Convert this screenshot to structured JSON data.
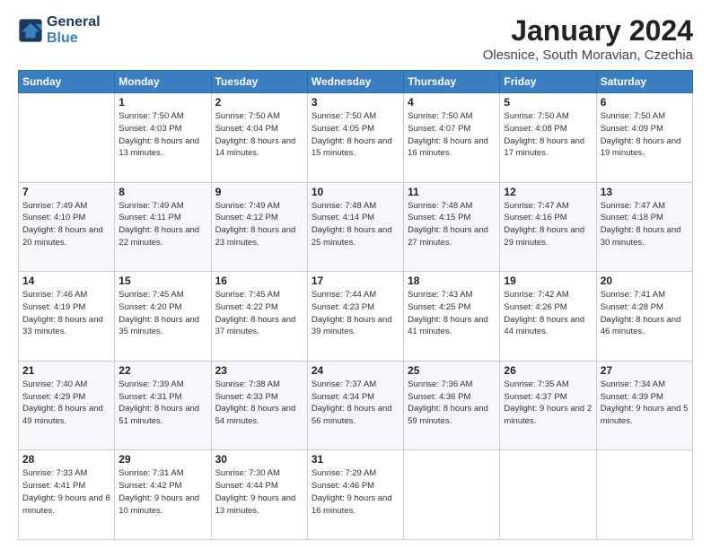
{
  "header": {
    "logo_line1": "General",
    "logo_line2": "Blue",
    "title": "January 2024",
    "subtitle": "Olesnice, South Moravian, Czechia"
  },
  "weekdays": [
    "Sunday",
    "Monday",
    "Tuesday",
    "Wednesday",
    "Thursday",
    "Friday",
    "Saturday"
  ],
  "weeks": [
    [
      {
        "day": "",
        "sunrise": "",
        "sunset": "",
        "daylight": ""
      },
      {
        "day": "1",
        "sunrise": "Sunrise: 7:50 AM",
        "sunset": "Sunset: 4:03 PM",
        "daylight": "Daylight: 8 hours and 13 minutes."
      },
      {
        "day": "2",
        "sunrise": "Sunrise: 7:50 AM",
        "sunset": "Sunset: 4:04 PM",
        "daylight": "Daylight: 8 hours and 14 minutes."
      },
      {
        "day": "3",
        "sunrise": "Sunrise: 7:50 AM",
        "sunset": "Sunset: 4:05 PM",
        "daylight": "Daylight: 8 hours and 15 minutes."
      },
      {
        "day": "4",
        "sunrise": "Sunrise: 7:50 AM",
        "sunset": "Sunset: 4:07 PM",
        "daylight": "Daylight: 8 hours and 16 minutes."
      },
      {
        "day": "5",
        "sunrise": "Sunrise: 7:50 AM",
        "sunset": "Sunset: 4:08 PM",
        "daylight": "Daylight: 8 hours and 17 minutes."
      },
      {
        "day": "6",
        "sunrise": "Sunrise: 7:50 AM",
        "sunset": "Sunset: 4:09 PM",
        "daylight": "Daylight: 8 hours and 19 minutes."
      }
    ],
    [
      {
        "day": "7",
        "sunrise": "Sunrise: 7:49 AM",
        "sunset": "Sunset: 4:10 PM",
        "daylight": "Daylight: 8 hours and 20 minutes."
      },
      {
        "day": "8",
        "sunrise": "Sunrise: 7:49 AM",
        "sunset": "Sunset: 4:11 PM",
        "daylight": "Daylight: 8 hours and 22 minutes."
      },
      {
        "day": "9",
        "sunrise": "Sunrise: 7:49 AM",
        "sunset": "Sunset: 4:12 PM",
        "daylight": "Daylight: 8 hours and 23 minutes."
      },
      {
        "day": "10",
        "sunrise": "Sunrise: 7:48 AM",
        "sunset": "Sunset: 4:14 PM",
        "daylight": "Daylight: 8 hours and 25 minutes."
      },
      {
        "day": "11",
        "sunrise": "Sunrise: 7:48 AM",
        "sunset": "Sunset: 4:15 PM",
        "daylight": "Daylight: 8 hours and 27 minutes."
      },
      {
        "day": "12",
        "sunrise": "Sunrise: 7:47 AM",
        "sunset": "Sunset: 4:16 PM",
        "daylight": "Daylight: 8 hours and 29 minutes."
      },
      {
        "day": "13",
        "sunrise": "Sunrise: 7:47 AM",
        "sunset": "Sunset: 4:18 PM",
        "daylight": "Daylight: 8 hours and 30 minutes."
      }
    ],
    [
      {
        "day": "14",
        "sunrise": "Sunrise: 7:46 AM",
        "sunset": "Sunset: 4:19 PM",
        "daylight": "Daylight: 8 hours and 33 minutes."
      },
      {
        "day": "15",
        "sunrise": "Sunrise: 7:45 AM",
        "sunset": "Sunset: 4:20 PM",
        "daylight": "Daylight: 8 hours and 35 minutes."
      },
      {
        "day": "16",
        "sunrise": "Sunrise: 7:45 AM",
        "sunset": "Sunset: 4:22 PM",
        "daylight": "Daylight: 8 hours and 37 minutes."
      },
      {
        "day": "17",
        "sunrise": "Sunrise: 7:44 AM",
        "sunset": "Sunset: 4:23 PM",
        "daylight": "Daylight: 8 hours and 39 minutes."
      },
      {
        "day": "18",
        "sunrise": "Sunrise: 7:43 AM",
        "sunset": "Sunset: 4:25 PM",
        "daylight": "Daylight: 8 hours and 41 minutes."
      },
      {
        "day": "19",
        "sunrise": "Sunrise: 7:42 AM",
        "sunset": "Sunset: 4:26 PM",
        "daylight": "Daylight: 8 hours and 44 minutes."
      },
      {
        "day": "20",
        "sunrise": "Sunrise: 7:41 AM",
        "sunset": "Sunset: 4:28 PM",
        "daylight": "Daylight: 8 hours and 46 minutes."
      }
    ],
    [
      {
        "day": "21",
        "sunrise": "Sunrise: 7:40 AM",
        "sunset": "Sunset: 4:29 PM",
        "daylight": "Daylight: 8 hours and 49 minutes."
      },
      {
        "day": "22",
        "sunrise": "Sunrise: 7:39 AM",
        "sunset": "Sunset: 4:31 PM",
        "daylight": "Daylight: 8 hours and 51 minutes."
      },
      {
        "day": "23",
        "sunrise": "Sunrise: 7:38 AM",
        "sunset": "Sunset: 4:33 PM",
        "daylight": "Daylight: 8 hours and 54 minutes."
      },
      {
        "day": "24",
        "sunrise": "Sunrise: 7:37 AM",
        "sunset": "Sunset: 4:34 PM",
        "daylight": "Daylight: 8 hours and 56 minutes."
      },
      {
        "day": "25",
        "sunrise": "Sunrise: 7:36 AM",
        "sunset": "Sunset: 4:36 PM",
        "daylight": "Daylight: 8 hours and 59 minutes."
      },
      {
        "day": "26",
        "sunrise": "Sunrise: 7:35 AM",
        "sunset": "Sunset: 4:37 PM",
        "daylight": "Daylight: 9 hours and 2 minutes."
      },
      {
        "day": "27",
        "sunrise": "Sunrise: 7:34 AM",
        "sunset": "Sunset: 4:39 PM",
        "daylight": "Daylight: 9 hours and 5 minutes."
      }
    ],
    [
      {
        "day": "28",
        "sunrise": "Sunrise: 7:33 AM",
        "sunset": "Sunset: 4:41 PM",
        "daylight": "Daylight: 9 hours and 8 minutes."
      },
      {
        "day": "29",
        "sunrise": "Sunrise: 7:31 AM",
        "sunset": "Sunset: 4:42 PM",
        "daylight": "Daylight: 9 hours and 10 minutes."
      },
      {
        "day": "30",
        "sunrise": "Sunrise: 7:30 AM",
        "sunset": "Sunset: 4:44 PM",
        "daylight": "Daylight: 9 hours and 13 minutes."
      },
      {
        "day": "31",
        "sunrise": "Sunrise: 7:29 AM",
        "sunset": "Sunset: 4:46 PM",
        "daylight": "Daylight: 9 hours and 16 minutes."
      },
      {
        "day": "",
        "sunrise": "",
        "sunset": "",
        "daylight": ""
      },
      {
        "day": "",
        "sunrise": "",
        "sunset": "",
        "daylight": ""
      },
      {
        "day": "",
        "sunrise": "",
        "sunset": "",
        "daylight": ""
      }
    ]
  ]
}
